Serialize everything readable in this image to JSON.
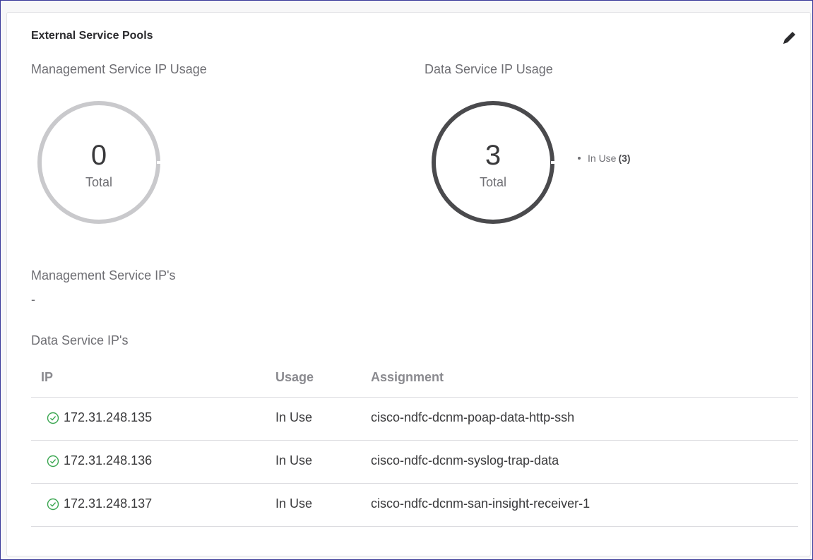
{
  "card": {
    "title": "External Service Pools",
    "edit_icon": "pencil-icon"
  },
  "management_gauge": {
    "label": "Management Service IP Usage",
    "value": "0",
    "unit_label": "Total",
    "ring_color": "#c9c9cc"
  },
  "data_gauge": {
    "label": "Data Service IP Usage",
    "value": "3",
    "unit_label": "Total",
    "ring_color": "#4a4a4d",
    "legend": {
      "label": "In Use",
      "count": "(3)"
    }
  },
  "management_ips": {
    "label": "Management Service IP's",
    "empty_value": "-"
  },
  "data_ips": {
    "label": "Data Service IP's",
    "columns": [
      "IP",
      "Usage",
      "Assignment"
    ],
    "status_icon": "check-circle-icon",
    "status_color": "#3aa650",
    "rows": [
      {
        "ip": "172.31.248.135",
        "usage": "In Use",
        "assignment": "cisco-ndfc-dcnm-poap-data-http-ssh"
      },
      {
        "ip": "172.31.248.136",
        "usage": "In Use",
        "assignment": "cisco-ndfc-dcnm-syslog-trap-data"
      },
      {
        "ip": "172.31.248.137",
        "usage": "In Use",
        "assignment": "cisco-ndfc-dcnm-san-insight-receiver-1"
      }
    ]
  }
}
